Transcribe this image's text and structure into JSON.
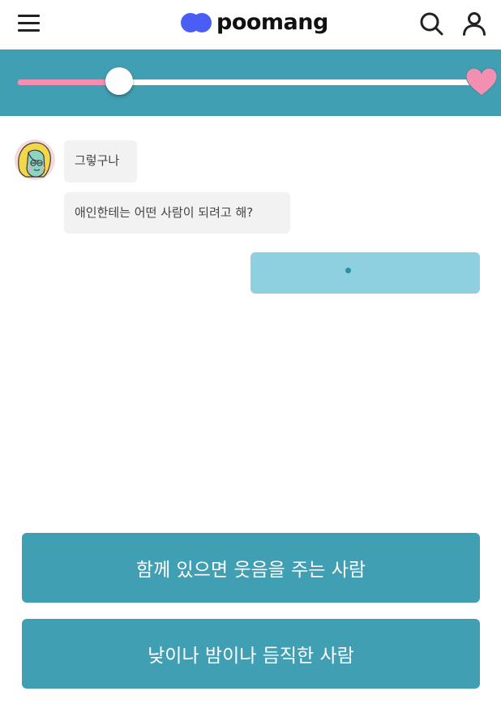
{
  "header": {
    "brand": "poomang",
    "icons": {
      "menu": "hamburger-menu-icon",
      "logo": "poomang-logo-icon",
      "search": "search-icon",
      "user": "user-icon"
    }
  },
  "progress": {
    "value": 0.22,
    "end_icon": "heart-icon"
  },
  "chat": {
    "avatar_icon": "character-avatar-icon",
    "messages": [
      "그렇구나",
      "애인한테는 어떤 사람이 되려고 해?"
    ],
    "reply_state_icon": "typing-indicator-icon"
  },
  "answers": [
    "함께 있으면 웃음을 주는 사람",
    "낮이나 밤이나 듬직한 사람"
  ],
  "colors": {
    "accent": "#419fb3",
    "progress_fill": "#f48fb1",
    "heart": "#f48fb1",
    "reply_bubble": "#8ed0e0",
    "bubble_bg": "#f2f2f2",
    "logo_blue": "#4a5df5"
  }
}
